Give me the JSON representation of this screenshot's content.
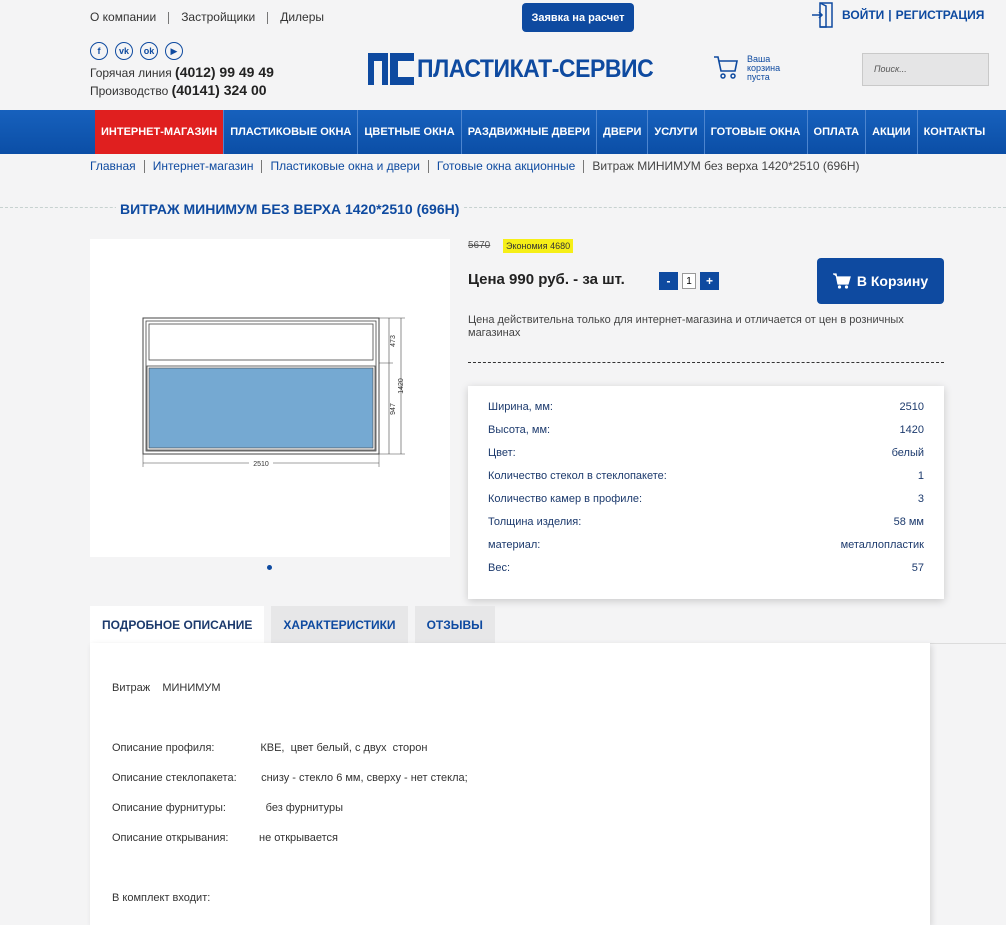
{
  "header": {
    "top_links": [
      "О компании",
      "Застройщики",
      "Дилеры"
    ],
    "request_button": "Заявка на расчет",
    "login": "ВОЙТИ",
    "register": "РЕГИСТРАЦИЯ",
    "socials": [
      "f",
      "vk",
      "ok",
      "▶"
    ],
    "hotline_label": "Горячая линия",
    "hotline_number": "(4012) 99 49 49",
    "production_label": "Производство",
    "production_number": "(40141) 324 00",
    "logo_text": "ПЛАСТИКАТ-СЕРВИС",
    "cart_text": "Ваша корзина пуста",
    "search_placeholder": "Поиск..."
  },
  "nav": [
    "ИНТЕРНЕТ-МАГАЗИН",
    "ПЛАСТИКОВЫЕ ОКНА",
    "ЦВЕТНЫЕ ОКНА",
    "РАЗДВИЖНЫЕ ДВЕРИ",
    "ДВЕРИ",
    "УСЛУГИ",
    "ГОТОВЫЕ ОКНА",
    "ОПЛАТА",
    "АКЦИИ",
    "КОНТАКТЫ"
  ],
  "breadcrumb": [
    "Главная",
    "Интернет-магазин",
    "Пластиковые окна и двери",
    "Готовые окна акционные",
    "Витраж МИНИМУМ без верха 1420*2510 (696Н)"
  ],
  "product": {
    "title": "ВИТРАЖ МИНИМУМ БЕЗ ВЕРХА 1420*2510 (696Н)",
    "old_price": "5670",
    "economy": "Экономия 4680",
    "price": "Цена 990 руб. - за шт.",
    "quantity": "1",
    "qty_minus": "-",
    "qty_plus": "+",
    "cart_button": "В Корзину",
    "price_note": "Цена действительна только для интернет-магазина и отличается от цен в розничных магазинах",
    "drawing": {
      "width_label": "2510",
      "height_label": "1420",
      "top_label": "473",
      "bottom_label": "947"
    }
  },
  "specs": [
    {
      "label": "Ширина, мм:",
      "value": "2510"
    },
    {
      "label": "Высота, мм:",
      "value": "1420"
    },
    {
      "label": "Цвет:",
      "value": "белый"
    },
    {
      "label": "Количество стекол в стеклопакете:",
      "value": "1"
    },
    {
      "label": "Количество камер в профиле:",
      "value": "3"
    },
    {
      "label": "Толщина изделия:",
      "value": "58 мм"
    },
    {
      "label": "материал:",
      "value": "металлопластик"
    },
    {
      "label": "Вес:",
      "value": "57"
    }
  ],
  "tabs": [
    "ПОДРОБНОЕ ОПИСАНИЕ",
    "ХАРАКТЕРИСТИКИ",
    "ОТЗЫВЫ"
  ],
  "description": {
    "line1": "Витраж    МИНИМУМ",
    "line2": "Описание профиля:               КВЕ,  цвет белый, с двух  сторон",
    "line3": "Описание стеклопакета:        снизу - стекло 6 мм, сверху - нет стекла;",
    "line4": "Описание фурнитуры:             без фурнитуры",
    "line5": "Описание открывания:          не открывается",
    "line6": "В комплект входит:"
  },
  "colors": {
    "brand_blue": "#0e4aa0",
    "nav_active": "#e01f1f",
    "economy_bg": "#f6ef17",
    "glass": "#75a9d2"
  }
}
